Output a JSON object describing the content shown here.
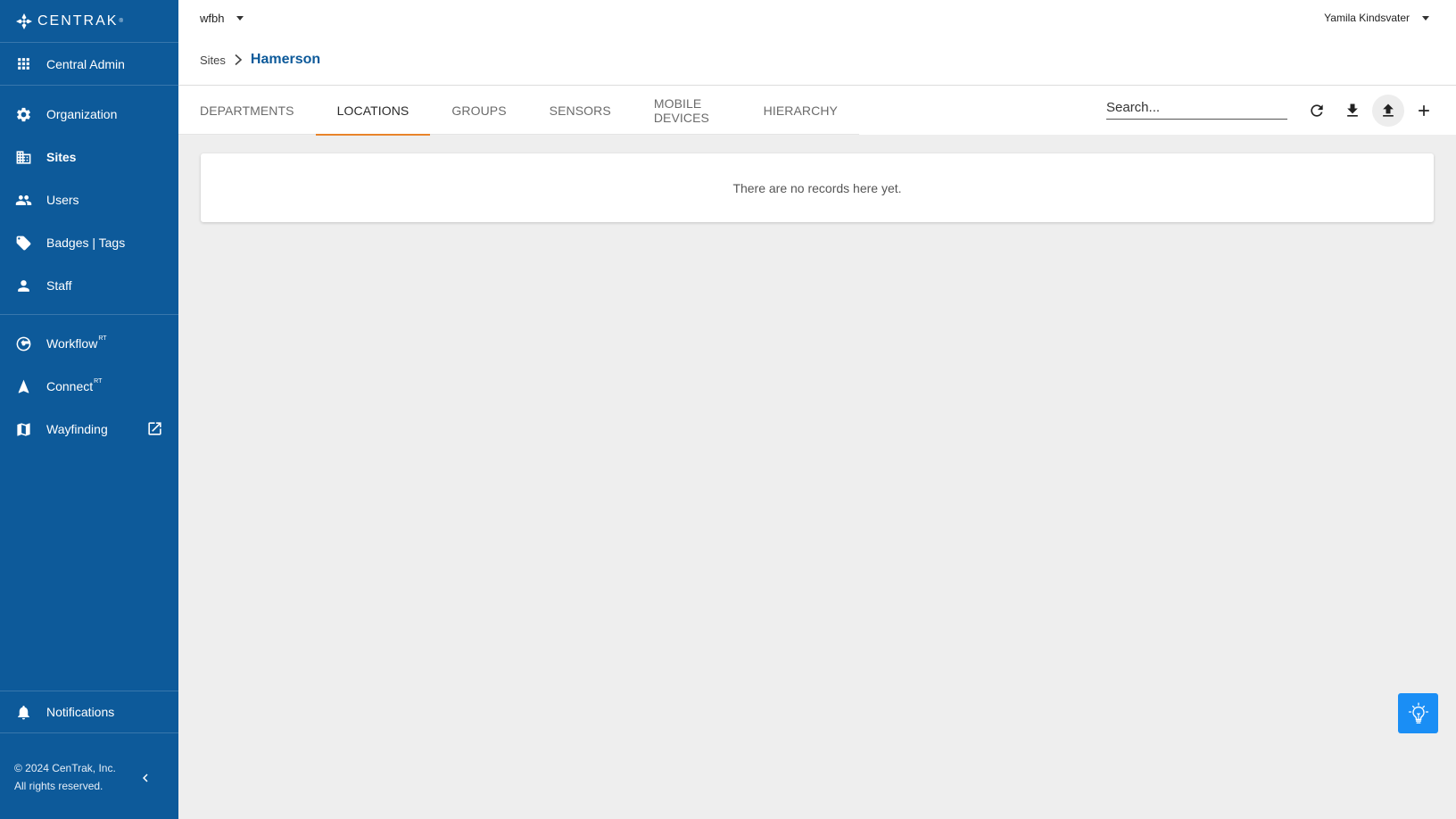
{
  "brand": {
    "name": "CENTRAK",
    "reg": "®"
  },
  "sidebar": {
    "top_item": {
      "label": "Central Admin",
      "icon": "apps-grid-icon"
    },
    "items": [
      {
        "label": "Organization",
        "icon": "gear-icon",
        "active": false
      },
      {
        "label": "Sites",
        "icon": "building-icon",
        "active": true
      },
      {
        "label": "Users",
        "icon": "people-icon",
        "active": false
      },
      {
        "label": "Badges | Tags",
        "icon": "tag-icon",
        "active": false
      },
      {
        "label": "Staff",
        "icon": "person-icon",
        "active": false
      }
    ],
    "apps": [
      {
        "label": "Workflow",
        "sup": "RT",
        "icon": "workflow-icon"
      },
      {
        "label": "Connect",
        "sup": "RT",
        "icon": "navigation-arrow-icon"
      },
      {
        "label": "Wayfinding",
        "sup": "",
        "icon": "map-icon",
        "external": true
      }
    ],
    "notifications": {
      "label": "Notifications",
      "icon": "bell-icon"
    },
    "footer": {
      "line1": "© 2024 CenTrak, Inc.",
      "line2": "All rights reserved."
    }
  },
  "header": {
    "tenant": "wfbh",
    "user": "Yamila Kindsvater",
    "breadcrumb": {
      "root": "Sites",
      "current": "Hamerson"
    }
  },
  "tabs": [
    {
      "label": "DEPARTMENTS",
      "active": false
    },
    {
      "label": "LOCATIONS",
      "active": true
    },
    {
      "label": "GROUPS",
      "active": false
    },
    {
      "label": "SENSORS",
      "active": false
    },
    {
      "label": "MOBILE DEVICES",
      "active": false
    },
    {
      "label": "HIERARCHY",
      "active": false
    }
  ],
  "search": {
    "placeholder": "Search...",
    "value": ""
  },
  "toolbar": {
    "icons": [
      "refresh-icon",
      "download-icon",
      "upload-icon",
      "add-icon"
    ]
  },
  "content": {
    "empty_message": "There are no records here yet."
  },
  "colors": {
    "sidebar_bg": "#0d5a9a",
    "accent": "#e8832a",
    "help_button": "#1a8ef5"
  }
}
